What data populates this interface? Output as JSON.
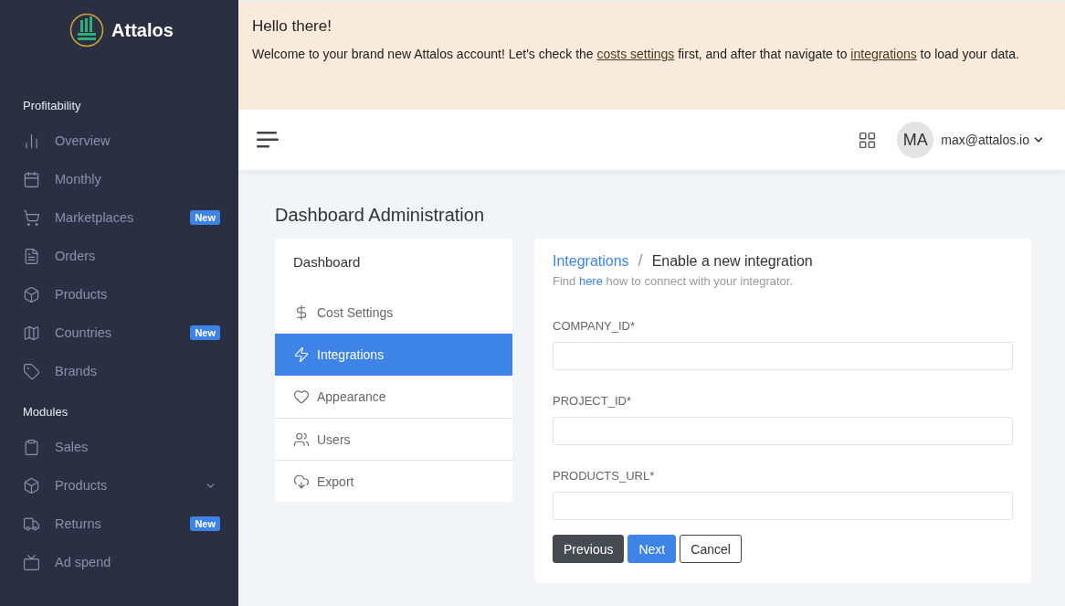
{
  "brand": {
    "name": "Attalos"
  },
  "sidebar": {
    "sections": [
      {
        "title": "Profitability",
        "items": [
          {
            "label": "Overview"
          },
          {
            "label": "Monthly"
          },
          {
            "label": "Marketplaces",
            "badge": "New"
          },
          {
            "label": "Orders"
          },
          {
            "label": "Products"
          },
          {
            "label": "Countries",
            "badge": "New"
          },
          {
            "label": "Brands"
          }
        ]
      },
      {
        "title": "Modules",
        "items": [
          {
            "label": "Sales"
          },
          {
            "label": "Products",
            "expanded": false
          },
          {
            "label": "Returns",
            "badge": "New"
          },
          {
            "label": "Ad spend"
          }
        ]
      }
    ]
  },
  "banner": {
    "title": "Hello there!",
    "text_1": "Welcome to your brand new Attalos account! Let's check the ",
    "link_1": "costs settings",
    "text_2": " first, and after that navigate to ",
    "link_2": "integrations",
    "text_3": " to load your data."
  },
  "header": {
    "avatar": "MA",
    "user": "max@attalos.io"
  },
  "page_title": "Dashboard Administration",
  "settings_menu": {
    "title": "Dashboard",
    "items": [
      {
        "label": "Cost Settings",
        "selected": false
      },
      {
        "label": "Integrations",
        "selected": true
      },
      {
        "label": "Appearance",
        "selected": false
      },
      {
        "label": "Users",
        "selected": false
      },
      {
        "label": "Export",
        "selected": false
      }
    ]
  },
  "form": {
    "separator": "/",
    "breadcrumb": [
      {
        "label": "Integrations",
        "link": true
      },
      {
        "label": "Enable a new integration",
        "link": false
      }
    ],
    "hint_1": "Find ",
    "hint_link": "here",
    "hint_2": " how to connect with your integrator.",
    "fields": [
      {
        "label": "COMPANY_ID*"
      },
      {
        "label": "PROJECT_ID*"
      },
      {
        "label": "PRODUCTS_URL*"
      }
    ],
    "buttons": [
      {
        "label": "Previous",
        "kind": "dark"
      },
      {
        "label": "Next",
        "kind": "primary"
      },
      {
        "label": "Cancel",
        "kind": "outline"
      }
    ]
  }
}
